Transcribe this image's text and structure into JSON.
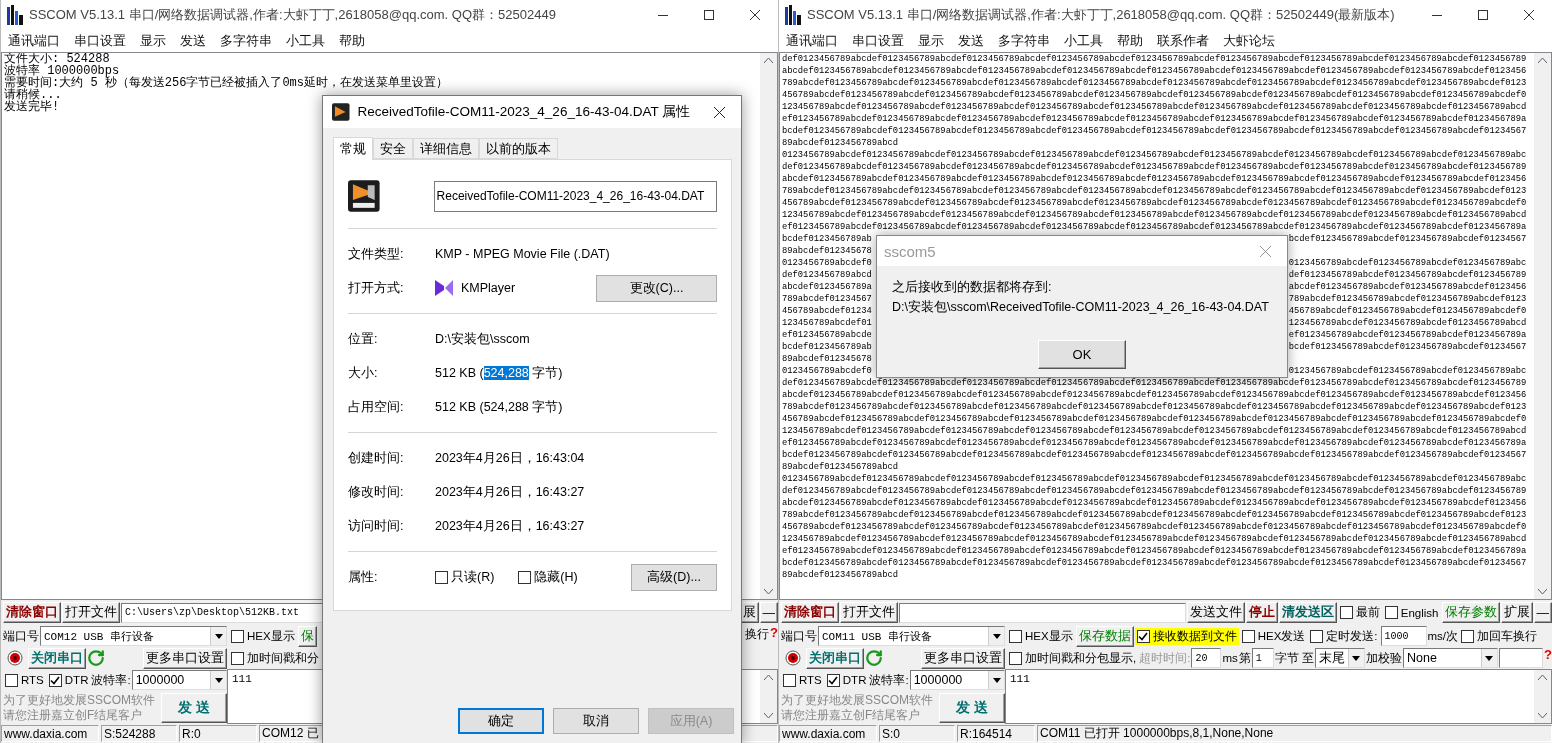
{
  "windows": [
    {
      "title": "SSCOM V5.13.1 串口/网络数据调试器,作者:大虾丁丁,2618058@qq.com. QQ群：52502449",
      "menu": [
        "通讯端口",
        "串口设置",
        "显示",
        "发送",
        "多字符串",
        "小工具",
        "帮助"
      ],
      "log_lines": [
        "文件大小: 524288",
        "波特率 1000000bps",
        "需要时间:大约 5 秒（每发送256字节已经被插入了0ms延时，在发送菜单里设置）",
        "请稍候...",
        "发送完毕!"
      ],
      "toolbar": [
        {
          "kind": "button",
          "label": "清除窗口",
          "color": "#8b0000",
          "bold": true
        },
        {
          "kind": "button",
          "label": "打开文件"
        },
        {
          "kind": "field",
          "value": "C:\\Users\\zp\\Desktop\\512KB.txt"
        },
        {
          "kind": "button",
          "label": "展"
        },
        {
          "kind": "button",
          "label": "—"
        }
      ],
      "port": {
        "label": "端口号",
        "device": "COM12 USB 串行设备",
        "toggle": "关闭串口",
        "more": "更多串口设置",
        "rts": {
          "label": "RTS",
          "checked": false
        },
        "dtr": {
          "label": "DTR",
          "checked": true
        },
        "baud_label": "波特率:",
        "baud": "1000000",
        "promo": [
          "为了更好地发展SSCOM软件",
          "请您注册嘉立创F结尾客户"
        ],
        "send": "发 送"
      },
      "options_rows": [
        {
          "items": [
            {
              "kind": "check",
              "label": "HEX显示",
              "checked": false
            },
            {
              "kind": "button",
              "label": "保",
              "color": "#008000"
            }
          ],
          "end_items": [
            {
              "kind": "text",
              "text": "换行"
            },
            {
              "kind": "help",
              "text": "?"
            }
          ]
        },
        {
          "items": [
            {
              "kind": "check",
              "label": "加时间戳和分",
              "checked": false
            }
          ]
        }
      ],
      "send_text": "111",
      "status": [
        "www.daxia.com",
        "S:524288",
        "R:0",
        "COM12 已"
      ]
    },
    {
      "title": "SSCOM V5.13.1 串口/网络数据调试器,作者:大虾丁丁,2618058@qq.com. QQ群：52502449(最新版本)",
      "menu": [
        "通讯端口",
        "串口设置",
        "显示",
        "发送",
        "多字符串",
        "小工具",
        "帮助",
        "联系作者",
        "大虾论坛"
      ],
      "received_lines": [
        {
          "text": "def0123456789abcdef0123456789abcdef0123456789abcdef0123456789abcdef0123456789abcdef0123456789abcdef0123456789abcdef0123456789abcdef0123456789"
        },
        {
          "text": "abcdef0123456789abcdef0123456789abcdef0123456789abcdef0123456789abcdef0123456789abcdef0123456789abcdef0123456789abcdef0123456789abcdef0123456"
        },
        {
          "text": "789abcdef0123456789abcdef0123456789abcdef0123456789abcdef0123456789abcdef0123456789abcdef0123456789abcdef0123456789abcdef0123456789abcdef0123"
        },
        {
          "text": "456789abcdef0123456789abcdef0123456789abcdef0123456789abcdef0123456789abcdef0123456789abcdef0123456789abcdef0123456789abcdef0123456789abcdef0"
        },
        {
          "text": "123456789abcdef0123456789abcdef0123456789abcdef0123456789abcdef0123456789abcdef0123456789abcdef0123456789abcdef0123456789abcdef0123456789abcd"
        },
        {
          "text": "ef0123456789abcdef0123456789abcdef0123456789abcdef0123456789abcdef0123456789abcdef0123456789abcdef0123456789abcdef0123456789abcdef0123456789a"
        },
        {
          "text": "bcdef0123456789abcdef0123456789abcdef0123456789abcdef0123456789abcdef0123456789abcdef0123456789abcdef0123456789abcdef0123456789abcdef01234567"
        },
        {
          "text": "89abcdef0123456789abcd"
        },
        {
          "text": "0123456789abcdef0123456789abcdef0123456789abcdef0123456789abcdef0123456789abcdef0123456789abcdef0123456789abcdef0123456789abcdef0123456789abc"
        },
        {
          "text": "def0123456789abcdef0123456789abcdef0123456789abcdef0123456789abcdef0123456789abcdef0123456789abcdef0123456789abcdef0123456789abcdef0123456789"
        },
        {
          "text": "abcdef0123456789abcdef0123456789abcdef0123456789abcdef0123456789abcdef0123456789abcdef0123456789abcdef0123456789abcdef0123456789abcdef0123456"
        },
        {
          "text": "789abcdef0123456789abcdef0123456789abcdef0123456789abcdef0123456789abcdef0123456789abcdef0123456789abcdef0123456789abcdef0123456789abcdef0123"
        },
        {
          "text": "456789abcdef0123456789abcdef0123456789abcdef0123456789abcdef0123456789abcdef0123456789abcdef0123456789abcdef0123456789abcdef0123456789abcdef0"
        },
        {
          "text": "123456789abcdef0123456789abcdef0123456789abcdef0123456789abcdef0123456789abcdef0123456789abcdef0123456789abcdef0123456789abcdef0123456789abcd"
        },
        {
          "text": "ef0123456789abcdef0123456789abcdef0123456789abcdef0123456789abcdef0123456789abcdef0123456789abcdef0123456789abcdef0123456789abcdef0123456789a"
        },
        {
          "parts": [
            "bcdef0123456789ab",
            "bcdef0123456789abcdef0123456789abcdef01234567"
          ]
        },
        {
          "parts": [
            "89abcdef012345678"
          ]
        },
        {
          "parts": [
            "0123456789abcdef0",
            "0123456789abcdef0123456789abcdef0123456789abc"
          ]
        },
        {
          "parts": [
            "def0123456789abcd",
            "def0123456789abcdef0123456789abcdef0123456789"
          ]
        },
        {
          "parts": [
            "abcdef0123456789a",
            "abcdef0123456789abcdef0123456789abcdef0123456"
          ]
        },
        {
          "parts": [
            "789abcdef01234567",
            "789abcdef0123456789abcdef0123456789abcdef0123"
          ]
        },
        {
          "parts": [
            "456789abcdef01234",
            "456789abcdef0123456789abcdef0123456789abcdef0"
          ]
        },
        {
          "parts": [
            "123456789abcdef01",
            "123456789abcdef0123456789abcdef0123456789abcd"
          ]
        },
        {
          "parts": [
            "ef0123456789abcde",
            "ef0123456789abcdef0123456789abcdef0123456789a"
          ]
        },
        {
          "parts": [
            "bcdef0123456789ab",
            "bcdef0123456789abcdef0123456789abcdef01234567"
          ]
        },
        {
          "parts": [
            "89abcdef012345678"
          ]
        },
        {
          "parts": [
            "0123456789abcdef0",
            "0123456789abcdef0123456789abcdef0123456789abc"
          ]
        },
        {
          "text": "def0123456789abcdef0123456789abcdef0123456789abcdef0123456789abcdef0123456789abcdef0123456789abcdef0123456789abcdef0123456789abcdef0123456789"
        },
        {
          "text": "abcdef0123456789abcdef0123456789abcdef0123456789abcdef0123456789abcdef0123456789abcdef0123456789abcdef0123456789abcdef0123456789abcdef0123456"
        },
        {
          "text": "789abcdef0123456789abcdef0123456789abcdef0123456789abcdef0123456789abcdef0123456789abcdef0123456789abcdef0123456789abcdef0123456789abcdef0123"
        },
        {
          "text": "456789abcdef0123456789abcdef0123456789abcdef0123456789abcdef0123456789abcdef0123456789abcdef0123456789abcdef0123456789abcdef0123456789abcdef0"
        },
        {
          "text": "123456789abcdef0123456789abcdef0123456789abcdef0123456789abcdef0123456789abcdef0123456789abcdef0123456789abcdef0123456789abcdef0123456789abcd"
        },
        {
          "text": "ef0123456789abcdef0123456789abcdef0123456789abcdef0123456789abcdef0123456789abcdef0123456789abcdef0123456789abcdef0123456789abcdef0123456789a"
        },
        {
          "text": "bcdef0123456789abcdef0123456789abcdef0123456789abcdef0123456789abcdef0123456789abcdef0123456789abcdef0123456789abcdef0123456789abcdef01234567"
        },
        {
          "text": "89abcdef0123456789abcd"
        },
        {
          "text": "0123456789abcdef0123456789abcdef0123456789abcdef0123456789abcdef0123456789abcdef0123456789abcdef0123456789abcdef0123456789abcdef0123456789abc"
        },
        {
          "text": "def0123456789abcdef0123456789abcdef0123456789abcdef0123456789abcdef0123456789abcdef0123456789abcdef0123456789abcdef0123456789abcdef0123456789"
        },
        {
          "text": "abcdef0123456789abcdef0123456789abcdef0123456789abcdef0123456789abcdef0123456789abcdef0123456789abcdef0123456789abcdef0123456789abcdef0123456"
        },
        {
          "text": "789abcdef0123456789abcdef0123456789abcdef0123456789abcdef0123456789abcdef0123456789abcdef0123456789abcdef0123456789abcdef0123456789abcdef0123"
        },
        {
          "text": "456789abcdef0123456789abcdef0123456789abcdef0123456789abcdef0123456789abcdef0123456789abcdef0123456789abcdef0123456789abcdef0123456789abcdef0"
        },
        {
          "text": "123456789abcdef0123456789abcdef0123456789abcdef0123456789abcdef0123456789abcdef0123456789abcdef0123456789abcdef0123456789abcdef0123456789abcd"
        },
        {
          "text": "ef0123456789abcdef0123456789abcdef0123456789abcdef0123456789abcdef0123456789abcdef0123456789abcdef0123456789abcdef0123456789abcdef0123456789a"
        },
        {
          "text": "bcdef0123456789abcdef0123456789abcdef0123456789abcdef0123456789abcdef0123456789abcdef0123456789abcdef0123456789abcdef0123456789abcdef01234567"
        },
        {
          "text": "89abcdef0123456789abcd"
        }
      ],
      "toolbar": [
        {
          "kind": "button",
          "label": "清除窗口",
          "color": "#8b0000",
          "bold": true
        },
        {
          "kind": "button",
          "label": "打开文件"
        },
        {
          "kind": "field"
        },
        {
          "kind": "button",
          "label": "发送文件"
        },
        {
          "kind": "button",
          "label": "停止",
          "color": "#8b0000",
          "bold": true
        },
        {
          "kind": "button",
          "label": "清发送区",
          "color": "#006060",
          "bold": true
        },
        {
          "kind": "check",
          "label": "最前",
          "checked": false
        },
        {
          "kind": "check",
          "label": "English",
          "checked": false
        },
        {
          "kind": "button",
          "label": "保存参数",
          "color": "#008000"
        },
        {
          "kind": "button",
          "label": "扩展"
        },
        {
          "kind": "button",
          "label": "—"
        }
      ],
      "port": {
        "label": "端口号",
        "device": "COM11 USB 串行设备",
        "toggle": "关闭串口",
        "more": "更多串口设置",
        "rts": {
          "label": "RTS",
          "checked": false
        },
        "dtr": {
          "label": "DTR",
          "checked": true
        },
        "baud_label": "波特率:",
        "baud": "1000000",
        "promo": [
          "为了更好地发展SSCOM软件",
          "请您注册嘉立创F结尾客户"
        ],
        "send": "发 送"
      },
      "options_rows": [
        {
          "items": [
            {
              "kind": "check",
              "label": "HEX显示",
              "checked": false
            },
            {
              "kind": "button",
              "label": "保存数据",
              "color": "#008000"
            },
            {
              "kind": "check",
              "label": "接收数据到文件",
              "checked": true,
              "highlighted": true
            },
            {
              "kind": "check",
              "label": "HEX发送",
              "checked": false
            },
            {
              "kind": "check",
              "label": "定时发送:",
              "checked": false
            },
            {
              "kind": "field",
              "value": "1000"
            },
            {
              "kind": "text",
              "text": "ms/次"
            },
            {
              "kind": "check",
              "label": "加回车换行",
              "checked": false
            }
          ]
        },
        {
          "items": [
            {
              "kind": "check",
              "label": "加时间戳和分包显示,",
              "checked": false
            },
            {
              "kind": "text",
              "text": "超时时间:",
              "muted": true
            },
            {
              "kind": "field",
              "value": "20"
            },
            {
              "kind": "text",
              "text": "ms"
            },
            {
              "kind": "text",
              "text": "第"
            },
            {
              "kind": "field",
              "value": "1"
            },
            {
              "kind": "text",
              "text": "字节 至"
            },
            {
              "kind": "combo",
              "value": "末尾"
            },
            {
              "kind": "text",
              "text": "加校验"
            },
            {
              "kind": "combo",
              "value": "None",
              "wide": true
            },
            {
              "kind": "field"
            }
          ],
          "end_items": [
            {
              "kind": "help",
              "text": "?"
            }
          ]
        }
      ],
      "send_text": "111",
      "status": [
        "www.daxia.com",
        "S:0",
        "R:164514",
        "COM11 已打开  1000000bps,8,1,None,None"
      ]
    }
  ],
  "properties_dialog": {
    "title": "ReceivedTofile-COM11-2023_4_26_16-43-04.DAT 属性",
    "tabs": [
      {
        "label": "常规",
        "selected": true
      },
      {
        "label": "安全",
        "selected": false
      },
      {
        "label": "详细信息",
        "selected": false
      },
      {
        "label": "以前的版本",
        "selected": false
      }
    ],
    "file_name": "ReceivedTofile-COM11-2023_4_26_16-43-04.DAT",
    "type_label": "文件类型:",
    "type": "KMP - MPEG Movie File (.DAT)",
    "opens_with_label": "打开方式:",
    "opens_with": "KMPlayer",
    "change_button": "更改(C)...",
    "location_label": "位置:",
    "location": "D:\\安装包\\sscom",
    "size_label": "大小:",
    "size": [
      {
        "text": "512 KB (",
        "selected": false
      },
      {
        "text": "524,288",
        "selected": true
      },
      {
        "text": " 字节)",
        "selected": false
      }
    ],
    "disk_size_label": "占用空间:",
    "disk_size": "512 KB (524,288 字节)",
    "times": [
      {
        "label": "创建时间:",
        "value": "2023年4月26日，16:43:04"
      },
      {
        "label": "修改时间:",
        "value": "2023年4月26日，16:43:27"
      },
      {
        "label": "访问时间:",
        "value": "2023年4月26日，16:43:27"
      }
    ],
    "attributes_label": "属性:",
    "attributes": [
      {
        "label": "只读(R)",
        "checked": false
      },
      {
        "label": "隐藏(H)",
        "checked": false
      }
    ],
    "advanced_button": "高级(D)...",
    "buttons": [
      {
        "label": "确定",
        "kind": "default"
      },
      {
        "label": "取消",
        "kind": "normal"
      },
      {
        "label": "应用(A)",
        "kind": "disabled"
      }
    ]
  },
  "message_box": {
    "title": "sscom5",
    "message": [
      "之后接收到的数据都将存到:",
      "D:\\安装包\\sscom\\ReceivedTofile-COM11-2023_4_26_16-43-04.DAT"
    ],
    "button": "OK"
  }
}
